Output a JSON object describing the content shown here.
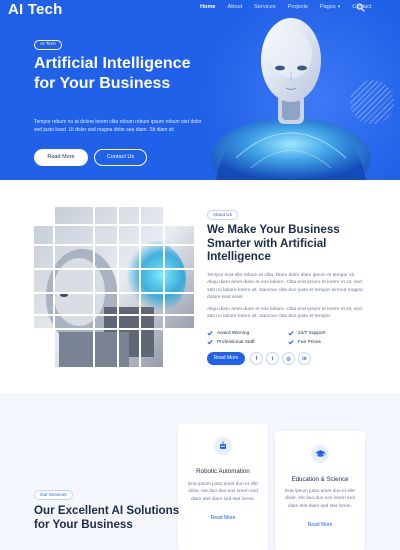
{
  "header": {
    "logo": "AI Tech",
    "nav": [
      {
        "label": "Home",
        "active": true
      },
      {
        "label": "About"
      },
      {
        "label": "Services"
      },
      {
        "label": "Projects"
      },
      {
        "label": "Pages",
        "dropdown": true
      },
      {
        "label": "Contact"
      }
    ],
    "search_icon": "search-icon"
  },
  "hero": {
    "badge": "AI Tech",
    "title": "Artificial Intelligence for Your Business",
    "text": "Tempor rebum no at dolore lorem clita rebum rebum ipsum rebum stet dolor sed justo kasd. Ut dolor sed magna dolor sea diam. Sit diam sit",
    "read_more": "Read More",
    "contact_us": "Contact Us"
  },
  "about": {
    "badge": "About Us",
    "title": "We Make Your Business Smarter with Artificial Intelligence",
    "paragraph_1": "Tempor erat elitr rebum at clita. Diam dolor diam ipsum et tempor sit. Aliqu diam amet diam et eos labore. Clita erat ipsum et lorem et sit, sed stet no labore lorem sit. Sanctus clita duo justo et tempor eirmod magna dolore erat amet",
    "paragraph_2": "Aliqu diam amet diam et eos labore. Clita erat ipsum et lorem et sit, sed stet no labore lorem sit. Sanctus clita duo justo et tempor.",
    "features": [
      "Award Winning",
      "24/7 Support",
      "Professional Staff",
      "Fair Prices"
    ],
    "read_more": "Read More",
    "social": [
      {
        "icon": "facebook-icon",
        "glyph": "f"
      },
      {
        "icon": "twitter-icon",
        "glyph": "t"
      },
      {
        "icon": "instagram-icon",
        "glyph": "◎"
      },
      {
        "icon": "linkedin-icon",
        "glyph": "in"
      }
    ]
  },
  "services": {
    "badge": "Our Services",
    "title": "Our Excellent AI Solutions for Your Business",
    "cards": [
      {
        "icon": "robot-icon",
        "title": "Robotic Automation",
        "text": "Erat ipsum justo amet duo et elitr dolor, est duo duo eos lorem sed diam stet diam sed stet lorem.",
        "link": "Read More"
      },
      {
        "icon": "graduation-cap-icon",
        "title": "Education & Science",
        "text": "Erat ipsum justo amet duo et elitr dolor, est duo duo eos lorem sed diam stet diam sed stet lorem.",
        "link": "Read More"
      }
    ]
  },
  "colors": {
    "primary": "#2160e8",
    "heading": "#1c2b46",
    "body_text": "#6b7791",
    "section_bg": "#f4f7fd"
  }
}
